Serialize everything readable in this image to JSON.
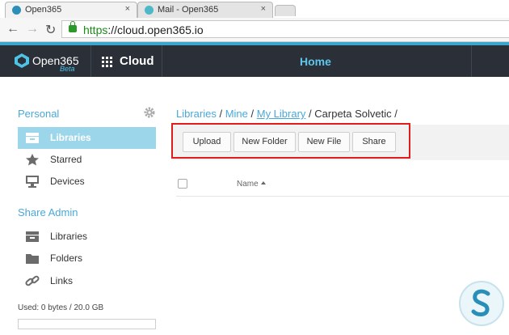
{
  "browser": {
    "tabs": [
      {
        "title": "Open365",
        "close": "×"
      },
      {
        "title": "Mail - Open365",
        "close": "×"
      }
    ],
    "url_scheme": "https",
    "url_rest": "://cloud.open365.io",
    "nav": {
      "back": "←",
      "forward": "→",
      "reload": "↻"
    }
  },
  "header": {
    "logo_text": "Open365",
    "logo_beta": "Beta",
    "app_label": "Cloud",
    "page_title": "Home"
  },
  "sidebar": {
    "personal_title": "Personal",
    "personal_items": [
      {
        "label": "Libraries",
        "icon": "libraries-icon",
        "active": true
      },
      {
        "label": "Starred",
        "icon": "star-icon"
      },
      {
        "label": "Devices",
        "icon": "monitor-icon"
      }
    ],
    "admin_title": "Share Admin",
    "admin_items": [
      {
        "label": "Libraries",
        "icon": "libraries-icon"
      },
      {
        "label": "Folders",
        "icon": "folder-icon"
      },
      {
        "label": "Links",
        "icon": "link-icon"
      }
    ],
    "usage_text": "Used: 0 bytes / 20.0 GB",
    "usage_fraction": 0
  },
  "main": {
    "breadcrumb": {
      "libraries": "Libraries",
      "sep": " / ",
      "mine": "Mine",
      "my_library": "My Library",
      "current": "Carpeta Solvetic",
      "trail": " /"
    },
    "buttons": {
      "upload": "Upload",
      "new_folder": "New Folder",
      "new_file": "New File",
      "share": "Share"
    },
    "table": {
      "name_header": "Name"
    }
  },
  "colors": {
    "accent": "#3aa6ce",
    "header_bg": "#2a2f38",
    "highlight": "#e21b1b"
  }
}
